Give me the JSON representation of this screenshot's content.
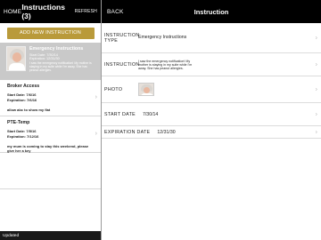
{
  "left": {
    "nav": {
      "home": "HOME",
      "title": "Instructions (3)",
      "refresh": "REFRESH"
    },
    "add_button": "ADD NEW INSTRUCTION",
    "selected": {
      "name": "Emergency Instructions",
      "start": "Start Date: 7/30/14",
      "expiration": "Expiration: 12/31/30",
      "desc": "I saw the emergency notification! My mother is staying in my suite while I'm away. She has peanut allergies."
    },
    "items": [
      {
        "name": "Broker Access",
        "start_label": "Start Date:",
        "start": "7/6/16",
        "exp_label": "Expiration:",
        "exp": "7/6/16",
        "desc": "allow abc to show my flat"
      },
      {
        "name": "PTE-Temp",
        "start_label": "Start Date:",
        "start": "7/5/16",
        "exp_label": "Expiration:",
        "exp": "7/12/16",
        "desc": "my mum is coming to stay this weekend, please give her a key"
      }
    ],
    "status": "Updated"
  },
  "right": {
    "nav": {
      "back": "BACK",
      "title": "Instruction"
    },
    "rows": {
      "type_label": "INSTRUCTION TYPE",
      "type_value": "Emergency Instructions",
      "instr_label": "INSTRUCTION",
      "instr_value": "I saw the emergency notification! My mother is staying in my suite while I'm away. She has peanut allergies.",
      "photo_label": "PHOTO",
      "start_label": "START DATE",
      "start_value": "7/30/14",
      "exp_label": "EXPIRATION DATE",
      "exp_value": "12/31/30"
    }
  },
  "colors": {
    "accent": "#b99a3a",
    "nav_bg": "#000000",
    "selected_bg": "#c9c9c9"
  },
  "icons": {
    "chevron": "chevron-right-icon",
    "avatar": "avatar"
  }
}
